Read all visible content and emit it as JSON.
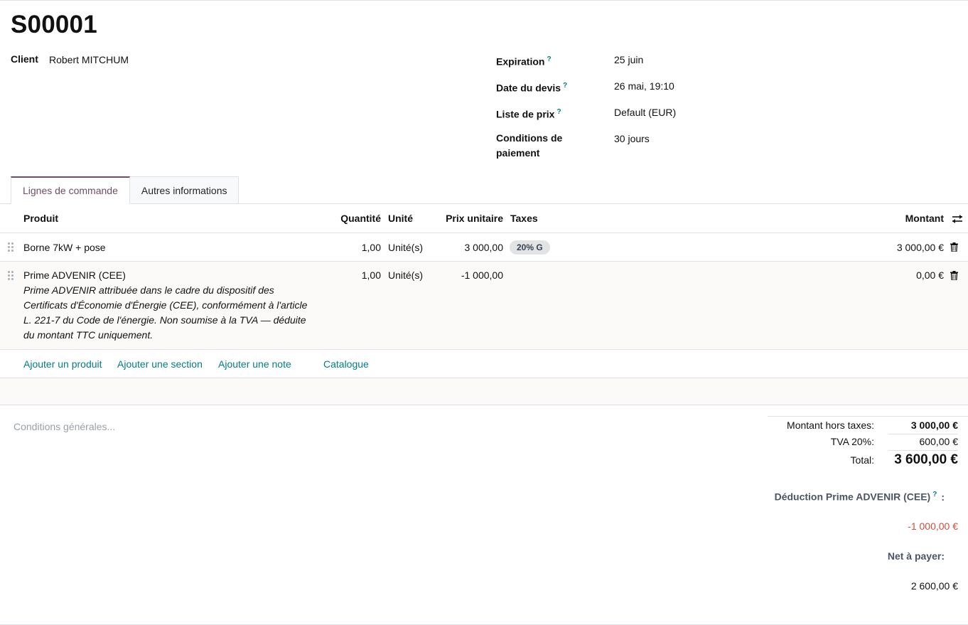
{
  "record": {
    "title": "S00001"
  },
  "left_fields": [
    {
      "label": "Client",
      "value": "Robert MITCHUM"
    }
  ],
  "right_fields": [
    {
      "label": "Expiration",
      "help": "?",
      "value": "25 juin"
    },
    {
      "label": "Date du devis",
      "help": "?",
      "value": "26 mai, 19:10"
    },
    {
      "label": "Liste de prix",
      "help": "?",
      "value": "Default (EUR)"
    },
    {
      "label_line1": "Conditions de",
      "label_line2": "paiement",
      "value": "30 jours"
    }
  ],
  "tabs": [
    {
      "label": "Lignes de commande",
      "active": true
    },
    {
      "label": "Autres informations",
      "active": false
    }
  ],
  "table": {
    "headers": {
      "product": "Produit",
      "quantity": "Quantité",
      "unit": "Unité",
      "price": "Prix unitaire",
      "taxes": "Taxes",
      "amount": "Montant"
    },
    "rows": [
      {
        "product": "Borne 7kW + pose",
        "quantity": "1,00",
        "unit": "Unité(s)",
        "price": "3 000,00",
        "tax": "20% G",
        "amount": "3 000,00 €"
      },
      {
        "product": "Prime ADVENIR (CEE)",
        "description": "Prime ADVENIR attribuée dans le cadre du dispositif des Certificats d'Économie d'Énergie (CEE), conformément à l'article L. 221-7 du Code de l'énergie. Non soumise à la TVA — déduite du montant TTC uniquement.",
        "quantity": "1,00",
        "unit": "Unité(s)",
        "price": "-1 000,00",
        "amount": "0,00 €"
      }
    ]
  },
  "actions": {
    "add_product": "Ajouter un produit",
    "add_section": "Ajouter une section",
    "add_note": "Ajouter une note",
    "catalog": "Catalogue"
  },
  "terms_placeholder": "Conditions générales...",
  "totals": {
    "untaxed_label": "Montant hors taxes:",
    "untaxed_value": "3 000,00 €",
    "tax_label": "TVA 20%:",
    "tax_value": "600,00 €",
    "total_label": "Total:",
    "total_value": "3 600,00 €",
    "deduction_label": "Déduction Prime ADVENIR (CEE)",
    "deduction_help": "?",
    "deduction_colon": ":",
    "deduction_value": "-1 000,00 €",
    "net_label": "Net à payer:",
    "net_value": "2 600,00 €"
  },
  "colors": {
    "accent": "#714b67",
    "link": "#017e84",
    "negative": "#d44c3b"
  }
}
